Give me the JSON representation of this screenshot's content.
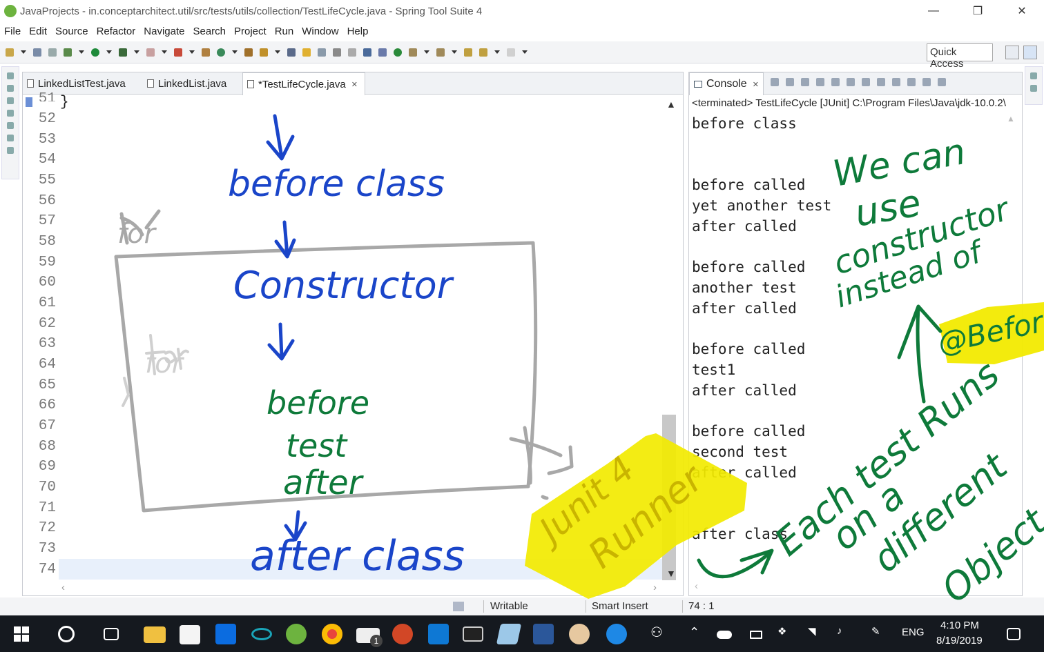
{
  "window": {
    "title": "JavaProjects - in.conceptarchitect.util/src/tests/utils/collection/TestLifeCycle.java - Spring Tool Suite 4",
    "controls": [
      "—",
      "❐",
      "✕"
    ]
  },
  "menu": [
    "File",
    "Edit",
    "Source",
    "Refactor",
    "Navigate",
    "Search",
    "Project",
    "Run",
    "Window",
    "Help"
  ],
  "toolbar": {
    "quick_access": "Quick Access"
  },
  "editor": {
    "tabs": [
      {
        "label": "LinkedListTest.java",
        "active": false
      },
      {
        "label": "LinkedList.java",
        "active": false
      },
      {
        "label": "*TestLifeCycle.java",
        "active": true
      }
    ],
    "close_glyph": "✕",
    "top_partial_line": "51",
    "brace": "}",
    "line_numbers": [
      "52",
      "53",
      "54",
      "55",
      "56",
      "57",
      "58",
      "59",
      "60",
      "61",
      "62",
      "63",
      "64",
      "65",
      "66",
      "67",
      "68",
      "69",
      "70",
      "71",
      "72",
      "73",
      "74"
    ]
  },
  "console": {
    "tab_label": "Console",
    "terminated": "<terminated> TestLifeCycle [JUnit] C:\\Program Files\\Java\\jdk-10.0.2\\",
    "lines": [
      "before class",
      "",
      "",
      "before called",
      "yet another test",
      "after called",
      "",
      "before called",
      "another test",
      "after called",
      "",
      "before called",
      "test1",
      "after called",
      "",
      "before called",
      "second test",
      "after called",
      "",
      "",
      "after class"
    ]
  },
  "statusbar": {
    "mode": "Writable",
    "insert": "Smart Insert",
    "position": "74 : 1"
  },
  "taskbar": {
    "lang": "ENG",
    "time": "4:10 PM",
    "date": "8/19/2019",
    "badge": "1"
  },
  "annotations": {
    "blue": [
      "before class",
      "Constructor",
      "before",
      "after class"
    ],
    "green_left": [
      "test",
      "after"
    ],
    "yellow_note": [
      "Junit 4",
      "Runner"
    ],
    "gray": [
      "for",
      "for"
    ],
    "green_right": [
      "We can",
      "use",
      "constructor",
      "instead of",
      "@Before",
      "Each test Runs",
      "on a",
      "different",
      "Object"
    ]
  },
  "colors": {
    "blue_ink": "#1a45c9",
    "green_ink": "#0e7a3a",
    "gray_ink": "#a8a8a8",
    "highlight": "#f2ea00",
    "accent": "#1a45c9"
  }
}
